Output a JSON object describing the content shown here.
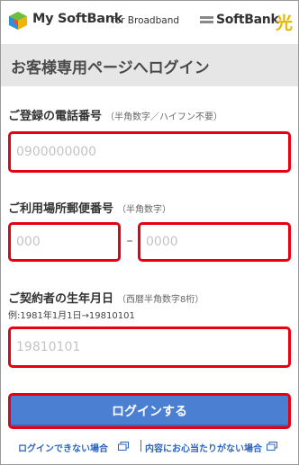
{
  "header": {
    "logo_text": "My SoftBank",
    "logo_sub": "for Broadband",
    "brand_text": "SoftBank",
    "brand_hikari": "光"
  },
  "page_title": "お客様専用ページへログイン",
  "phone": {
    "label": "ご登録の電話番号",
    "note": "（半角数字／ハイフン不要）",
    "placeholder": "0900000000"
  },
  "postal": {
    "label": "ご利用場所郵便番号",
    "note": "（半角数字）",
    "placeholder_first": "000",
    "separator": "–",
    "placeholder_second": "0000"
  },
  "birthday": {
    "label": "ご契約者の生年月日",
    "note": "（西暦半角数字8桁）",
    "example": "例:1981年1月1日→19810101",
    "placeholder": "19810101"
  },
  "login_button": "ログインする",
  "links": {
    "cannot_login": "ログインできない場合",
    "no_idea": "内容にお心当たりがない場合"
  },
  "colors": {
    "highlight": "#e60012",
    "button": "#4a7fd1",
    "link": "#2c64c0",
    "titlebar_bg": "#e6e6e6"
  }
}
